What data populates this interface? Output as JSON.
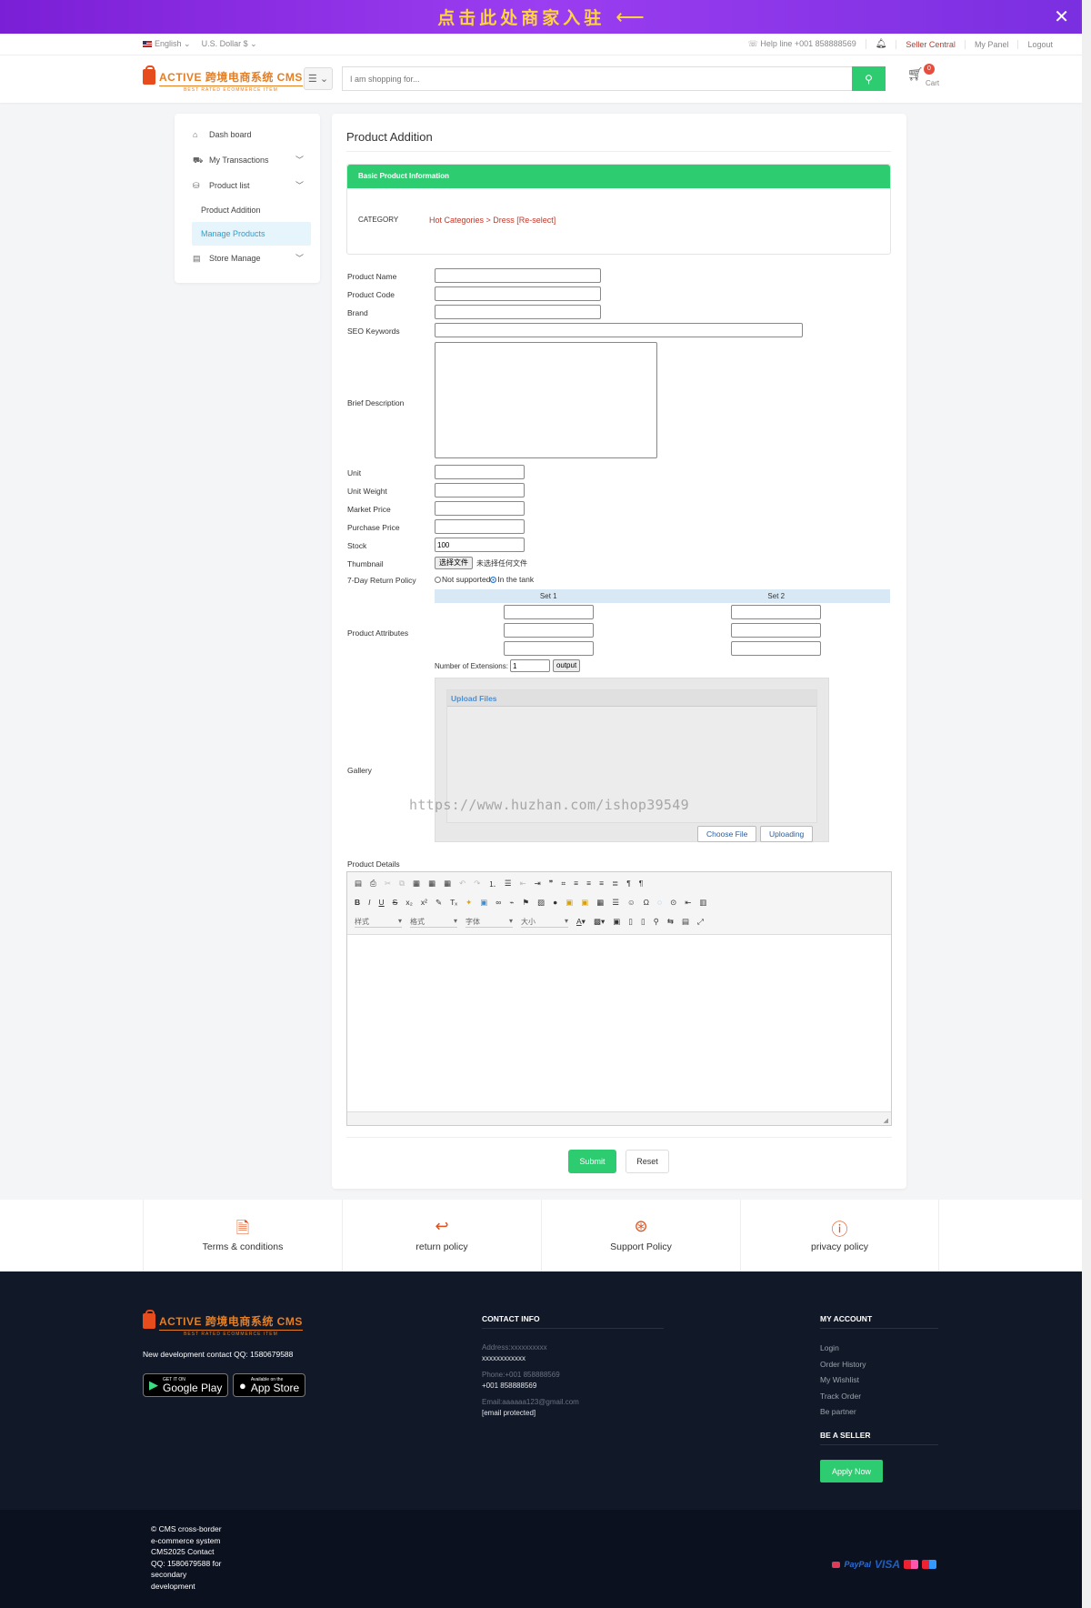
{
  "banner": {
    "text": "点击此处商家入驻",
    "arrow": "⟵",
    "close": "✕"
  },
  "topbar": {
    "language": "English",
    "currency": "U.S. Dollar $",
    "helpline": "Help line +001 858888569",
    "seller_central": "Seller Central",
    "my_panel": "My Panel",
    "logout": "Logout"
  },
  "header": {
    "logo_main": "ACTIVE 跨境电商系统 CMS",
    "logo_sub": "BEST RATED ECOMMERCE ITEM",
    "search_placeholder": "I am shopping for...",
    "cart_count": "0",
    "cart_label": "Cart"
  },
  "sidebar": {
    "dashboard": "Dash board",
    "transactions": "My Transactions",
    "product_list": "Product list",
    "product_addition": "Product Addition",
    "manage_products": "Manage Products",
    "store_manage": "Store Manage"
  },
  "form": {
    "page_title": "Product Addition",
    "basic_info_title": "Basic Product Information",
    "category_label": "CATEGORY",
    "category_value": "Hot Categories > Dress [Re-select]",
    "labels": {
      "product_name": "Product Name",
      "product_code": "Product Code",
      "brand": "Brand",
      "seo_keywords": "SEO Keywords",
      "brief_description": "Brief Description",
      "unit": "Unit",
      "unit_weight": "Unit Weight",
      "market_price": "Market Price",
      "purchase_price": "Purchase Price",
      "stock": "Stock",
      "thumbnail": "Thumbnail",
      "return_policy": "7-Day Return Policy",
      "product_attributes": "Product Attributes",
      "gallery": "Gallery",
      "product_details": "Product Details"
    },
    "stock_value": "100",
    "file_button": "选择文件",
    "file_none": "未选择任何文件",
    "return_options": [
      "Not supported",
      "In the tank"
    ],
    "return_selected": 1,
    "attr_sets": [
      "Set 1",
      "Set 2"
    ],
    "extensions_label": "Number of Extensions:",
    "extensions_value": "1",
    "output_button": "output",
    "gallery_title": "Upload Files",
    "choose_file": "Choose File",
    "uploading": "Uploading",
    "watermark": "https://www.huzhan.com/ishop39549",
    "editor_dropdowns": [
      "样式",
      "格式",
      "字体",
      "大小"
    ],
    "submit": "Submit",
    "reset": "Reset"
  },
  "policies": [
    "Terms & conditions",
    "return policy",
    "Support Policy",
    "privacy policy"
  ],
  "footer": {
    "contact_qq": "New development contact QQ: 1580679588",
    "google_small": "GET IT ON",
    "google_large": "Google Play",
    "apple_small": "Available on the",
    "apple_large": "App Store",
    "contact_title": "CONTACT INFO",
    "address_label": "Address:xxxxxxxxxx",
    "address_value": "xxxxxxxxxxxx",
    "phone_label": "Phone:+001 858888569",
    "phone_value": "+001 858888569",
    "email_label": "Email:aaaaaa123@gmail.com",
    "email_value": "[email protected]",
    "account_title": "MY ACCOUNT",
    "account_links": [
      "Login",
      "Order History",
      "My Wishlist",
      "Track Order",
      "Be partner"
    ],
    "seller_title": "BE A SELLER",
    "apply_now": "Apply Now",
    "copyright": "© CMS cross-border e-commerce system CMS2025 Contact QQ: 1580679588 for secondary development",
    "paypal": "PayPal",
    "visa": "VISA"
  }
}
